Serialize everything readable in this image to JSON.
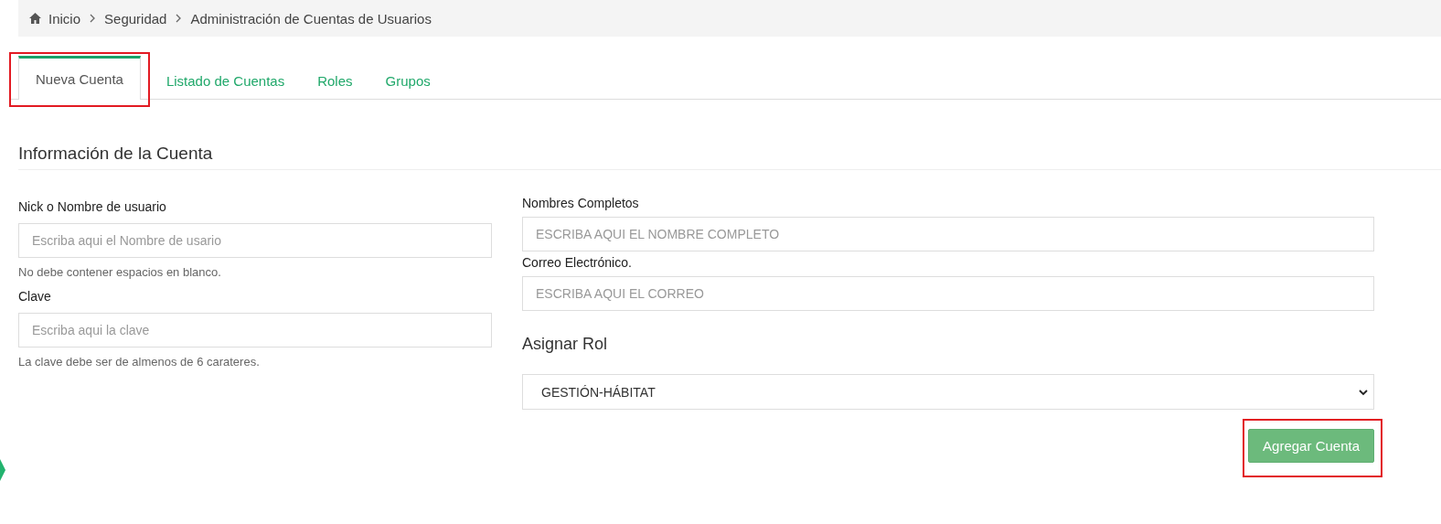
{
  "breadcrumb": [
    {
      "label": "Inicio",
      "kind": "home"
    },
    {
      "label": "Seguridad",
      "kind": "link"
    },
    {
      "label": "Administración de Cuentas de Usuarios",
      "kind": "current"
    }
  ],
  "tabs": [
    {
      "label": "Nueva Cuenta",
      "selected": true,
      "highlighted": true
    },
    {
      "label": "Listado de Cuentas",
      "selected": false,
      "highlighted": false
    },
    {
      "label": "Roles",
      "selected": false,
      "highlighted": false
    },
    {
      "label": "Grupos",
      "selected": false,
      "highlighted": false
    }
  ],
  "section_title": "Información de la Cuenta",
  "left_fields": [
    {
      "label": "Nick o Nombre de usuario",
      "placeholder": "Escriba aqui el Nombre de usario",
      "help": "No debe contener espacios en blanco."
    },
    {
      "label": "Clave",
      "placeholder": "Escriba aqui la clave",
      "help": "La clave debe ser de almenos de 6 carateres."
    }
  ],
  "right_fields": [
    {
      "label": "Nombres Completos",
      "placeholder": "ESCRIBA AQUI EL NOMBRE COMPLETO"
    },
    {
      "label": "Correo Electrónico.",
      "placeholder": "ESCRIBA AQUI EL CORREO"
    }
  ],
  "role": {
    "title": "Asignar Rol",
    "value": "GESTIÓN-HÁBITAT"
  },
  "submit": {
    "label": "Agregar Cuenta",
    "highlighted": true
  }
}
